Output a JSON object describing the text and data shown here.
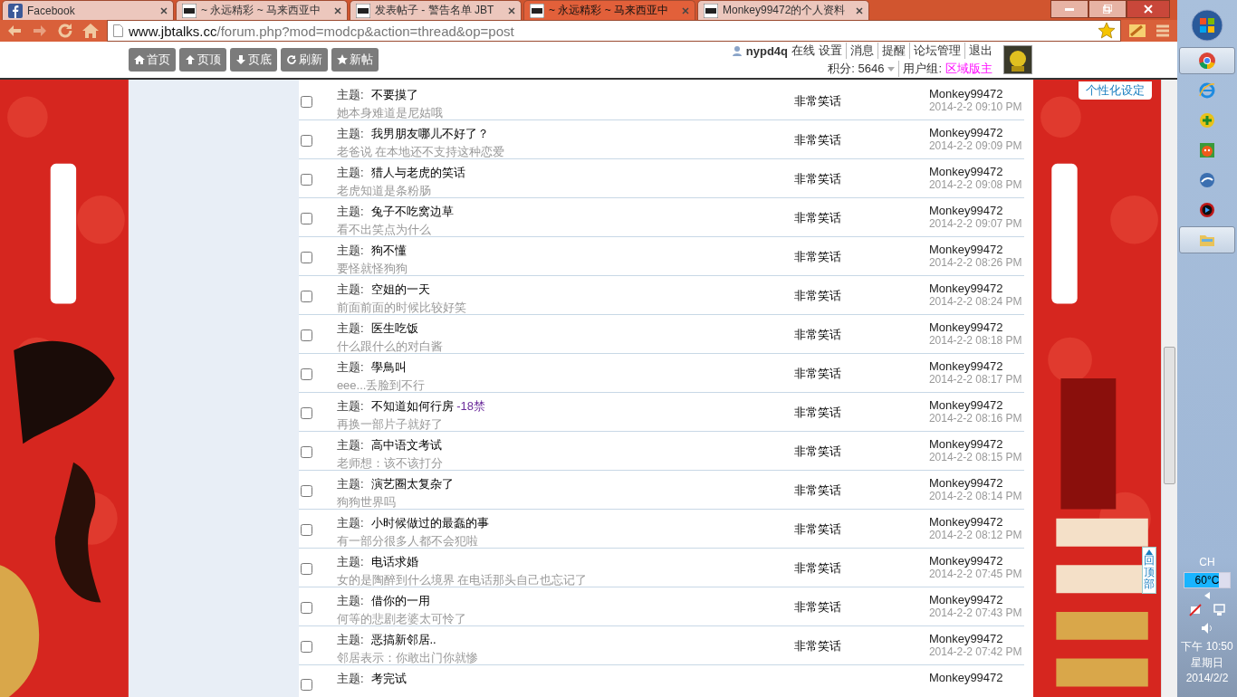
{
  "tabs": [
    {
      "title": "Facebook",
      "selected": false
    },
    {
      "title": "~ 永远精彩 ~ 马来西亚中",
      "selected": false
    },
    {
      "title": "发表帖子 - 警告名单 JBT",
      "selected": false
    },
    {
      "title": "~ 永远精彩 ~ 马来西亚中",
      "selected": true
    },
    {
      "title": "Monkey99472的个人资料",
      "selected": false
    }
  ],
  "address": {
    "host": "www.jbtalks.cc",
    "path": "/forum.php?mod=modcp&action=thread&op=post"
  },
  "nav_buttons": [
    "首页",
    "页顶",
    "页底",
    "刷新",
    "新帖"
  ],
  "user": {
    "name": "nypd4q",
    "links": [
      "在线",
      "设置",
      "消息",
      "提醒",
      "论坛管理",
      "退出"
    ],
    "points": "积分: 5646",
    "group_label": "用户组:",
    "group": "区域版主"
  },
  "personalize_button": "个性化设定",
  "back_to_top": "回顶部",
  "rows": [
    {
      "label": "主题:",
      "title": "不要摸了",
      "subtitle": "她本身难道是尼姑哦",
      "category": "非常笑话",
      "author": "Monkey99472",
      "date": "2014-2-2 09:10 PM",
      "checked": false
    },
    {
      "label": "主题:",
      "title": "我男朋友哪儿不好了？",
      "subtitle": "老爸说 在本地还不支持这种恋爱",
      "category": "非常笑话",
      "author": "Monkey99472",
      "date": "2014-2-2 09:09 PM",
      "checked": false
    },
    {
      "label": "主题:",
      "title": "猎人与老虎的笑话",
      "subtitle": "老虎知道是条粉肠",
      "category": "非常笑话",
      "author": "Monkey99472",
      "date": "2014-2-2 09:08 PM",
      "checked": false
    },
    {
      "label": "主题:",
      "title": "兔子不吃窝边草",
      "subtitle": "看不出笑点为什么",
      "category": "非常笑话",
      "author": "Monkey99472",
      "date": "2014-2-2 09:07 PM",
      "checked": false
    },
    {
      "label": "主题:",
      "title": "狗不懂",
      "subtitle": "要怪就怪狗狗",
      "category": "非常笑话",
      "author": "Monkey99472",
      "date": "2014-2-2 08:26 PM",
      "checked": false
    },
    {
      "label": "主题:",
      "title": "空姐的一天",
      "subtitle": "前面前面的时候比较好笑",
      "category": "非常笑话",
      "author": "Monkey99472",
      "date": "2014-2-2 08:24 PM",
      "checked": false
    },
    {
      "label": "主题:",
      "title": "医生吃饭",
      "subtitle": "什么跟什么的对白酱",
      "category": "非常笑话",
      "author": "Monkey99472",
      "date": "2014-2-2 08:18 PM",
      "checked": false
    },
    {
      "label": "主题:",
      "title": "學鳥叫",
      "subtitle": "eee...丢脸到不行",
      "category": "非常笑话",
      "author": "Monkey99472",
      "date": "2014-2-2 08:17 PM",
      "checked": false
    },
    {
      "label": "主题:",
      "title": "不知道如何行房",
      "tag": "-18禁",
      "subtitle": "再换一部片子就好了",
      "category": "非常笑话",
      "author": "Monkey99472",
      "date": "2014-2-2 08:16 PM",
      "checked": false
    },
    {
      "label": "主题:",
      "title": "高中语文考试",
      "subtitle": "老师想：该不该打分",
      "category": "非常笑话",
      "author": "Monkey99472",
      "date": "2014-2-2 08:15 PM",
      "checked": false
    },
    {
      "label": "主题:",
      "title": "演艺圈太复杂了",
      "subtitle": "狗狗世界吗",
      "category": "非常笑话",
      "author": "Monkey99472",
      "date": "2014-2-2 08:14 PM",
      "checked": false
    },
    {
      "label": "主题:",
      "title": "小时候做过的最蠢的事",
      "subtitle": "有一部分很多人都不会犯啦",
      "category": "非常笑话",
      "author": "Monkey99472",
      "date": "2014-2-2 08:12 PM",
      "checked": false
    },
    {
      "label": "主题:",
      "title": "电话求婚",
      "subtitle": "女的是陶醉到什么境界 在电话那头自己也忘记了",
      "category": "非常笑话",
      "author": "Monkey99472",
      "date": "2014-2-2 07:45 PM",
      "checked": false
    },
    {
      "label": "主题:",
      "title": "借你的一用",
      "subtitle": "何等的悲剧老婆太可怜了",
      "category": "非常笑话",
      "author": "Monkey99472",
      "date": "2014-2-2 07:43 PM",
      "checked": false
    },
    {
      "label": "主题:",
      "title": "恶搞新邻居..",
      "subtitle": "邻居表示：你敢出门你就惨",
      "category": "非常笑话",
      "author": "Monkey99472",
      "date": "2014-2-2 07:42 PM",
      "checked": false
    },
    {
      "label": "主题:",
      "title": "考完试",
      "author": "Monkey99472",
      "checked": false
    }
  ],
  "taskbar": {
    "apps": [
      {
        "active": true
      },
      {
        "active": false
      },
      {
        "active": false
      },
      {
        "active": false
      },
      {
        "active": false
      },
      {
        "active": false
      },
      {
        "active": true
      }
    ],
    "language": "CH",
    "temperature": {
      "text": "60°C",
      "level": 0.75
    },
    "time": "下午 10:50",
    "weekday": "星期日",
    "date": "2014/2/2"
  }
}
